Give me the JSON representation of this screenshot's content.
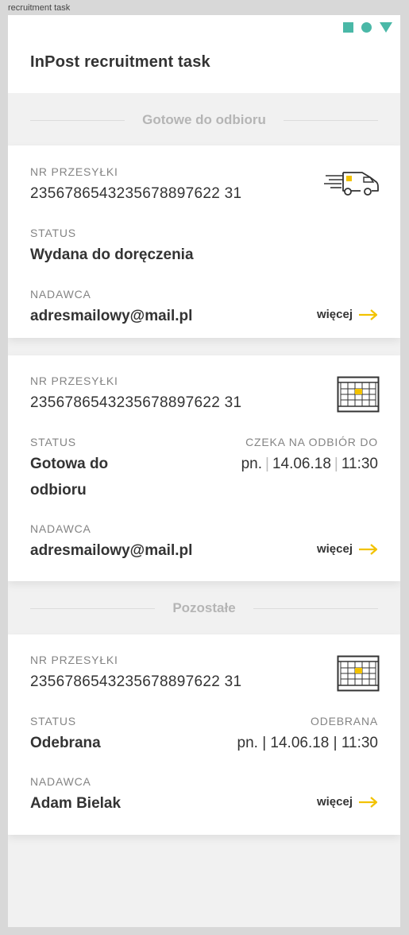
{
  "window": {
    "title": "recruitment task"
  },
  "header": {
    "title": "InPost recruitment task"
  },
  "colors": {
    "accent": "#4ab8a7",
    "highlight": "#f2c200",
    "background": "#f1f1f1"
  },
  "sections": {
    "ready": "Gotowe do odbioru",
    "other": "Pozostałe"
  },
  "cards": [
    {
      "number_label": "NR PRZESYŁKI",
      "number": "2356786543235678897622 31",
      "status_label": "STATUS",
      "status": "Wydana do doręczenia",
      "sender_label": "NADAWCA",
      "sender": "adresmailowy@mail.pl",
      "more": "więcej",
      "icon": "delivery-truck-icon"
    },
    {
      "number_label": "NR PRZESYŁKI",
      "number": "2356786543235678897622 31",
      "status_label": "STATUS",
      "status": "Gotowa do odbioru",
      "date_label": "CZEKA NA ODBIÓR DO",
      "date_day": "pn.",
      "date_date": "14.06.18",
      "date_time": "11:30",
      "sender_label": "NADAWCA",
      "sender": "adresmailowy@mail.pl",
      "more": "więcej",
      "icon": "parcel-locker-icon"
    },
    {
      "number_label": "NR PRZESYŁKI",
      "number": "2356786543235678897622 31",
      "status_label": "STATUS",
      "status": "Odebrana",
      "date_label": "ODEBRANA",
      "date_full": "pn. | 14.06.18 | 11:30",
      "sender_label": "NADAWCA",
      "sender": "Adam Bielak",
      "more": "więcej",
      "icon": "parcel-locker-icon"
    }
  ]
}
